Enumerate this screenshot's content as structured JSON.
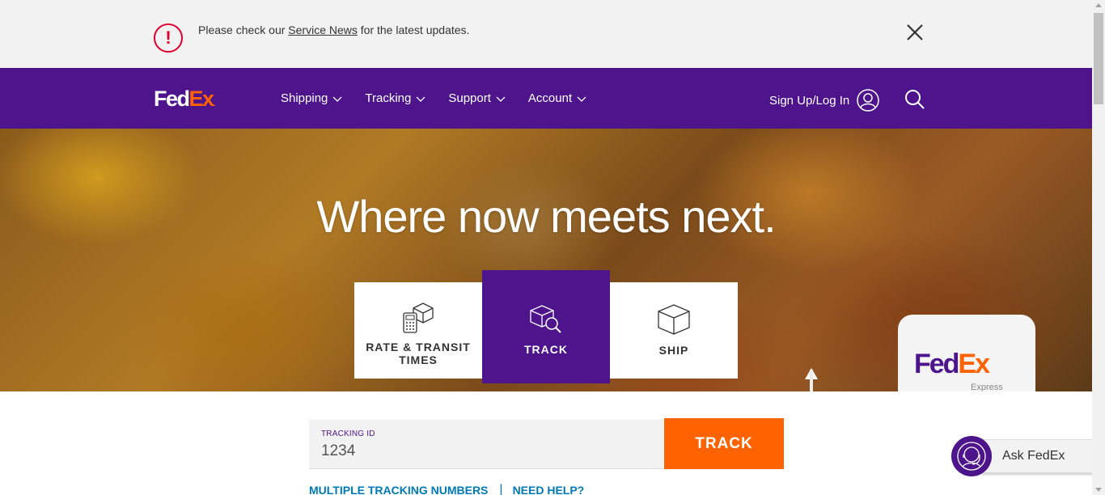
{
  "alert": {
    "icon": "exclamation-circle-icon",
    "text_before": "Please check our",
    "link": "Service News",
    "text_after": "for the latest updates.",
    "close_icon": "close-icon",
    "color": "#de002e"
  },
  "header": {
    "logo": {
      "fed": "Fed",
      "ex": "Ex",
      "dot": "."
    },
    "nav": [
      {
        "label": "Shipping"
      },
      {
        "label": "Tracking"
      },
      {
        "label": "Support"
      },
      {
        "label": "Account"
      }
    ],
    "signin_label": "Sign Up/Log In",
    "user_icon": "user-circle-icon",
    "search_icon": "search-icon",
    "brand_purple": "#4d148c",
    "brand_orange": "#ff6200"
  },
  "hero": {
    "title": "Where now meets next.",
    "tabs": [
      {
        "label_line1": "RATE & TRANSIT",
        "label_line2": "TIMES",
        "icon": "calculator-box-icon"
      },
      {
        "label": "TRACK",
        "icon": "box-search-icon",
        "active": true
      },
      {
        "label": "SHIP",
        "icon": "box-icon"
      }
    ],
    "van": {
      "fed": "Fed",
      "ex": "Ex",
      "sub": "Express"
    }
  },
  "tracking": {
    "field_label": "TRACKING ID",
    "value": "1234",
    "button_label": "TRACK",
    "links": [
      "MULTIPLE TRACKING NUMBERS",
      "NEED HELP?"
    ],
    "separator": "|"
  },
  "chat": {
    "label": "Ask FedEx",
    "icon": "agent-headset-icon"
  }
}
